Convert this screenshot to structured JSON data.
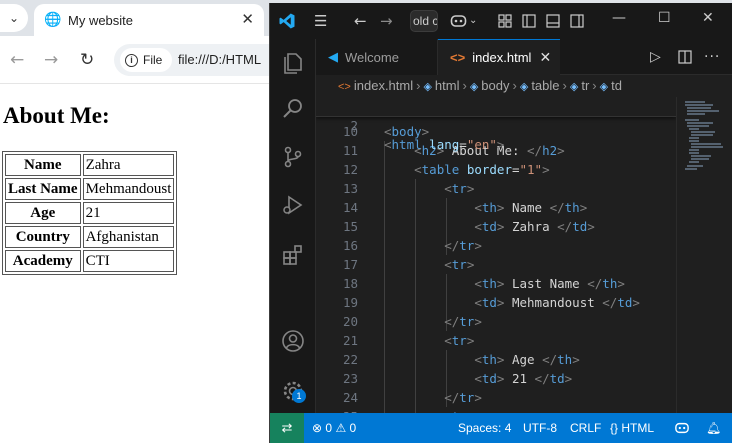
{
  "browser": {
    "tab_title": "My website",
    "omnibox": {
      "chip_label": "File",
      "url": "file:///D:/HTML"
    },
    "page": {
      "heading": "About Me:",
      "rows": [
        {
          "th": "Name",
          "td": "Zahra"
        },
        {
          "th": "Last Name",
          "td": "Mehmandoust"
        },
        {
          "th": "Age",
          "td": "21"
        },
        {
          "th": "Country",
          "td": "Afghanistan"
        },
        {
          "th": "Academy",
          "td": "CTI"
        }
      ]
    }
  },
  "vscode": {
    "search_text": "old c",
    "tabs": [
      {
        "label": "Welcome",
        "icon": "vscode-icon"
      },
      {
        "label": "index.html",
        "icon": "html-file-icon"
      }
    ],
    "breadcrumbs": [
      "index.html",
      "html",
      "body",
      "table",
      "tr",
      "td"
    ],
    "sticky_line": {
      "num": "2",
      "open": "<",
      "tag": "html",
      "attr": "lang",
      "eq": "=",
      "val": "\"en\"",
      "close": ">"
    },
    "lines": [
      {
        "num": "10",
        "open": "<",
        "tag": "body",
        "close": ">"
      },
      {
        "num": "11",
        "open": "<",
        "tag": "h2",
        "close": ">",
        "text": " About Me: ",
        "endopen": "</",
        "endtag": "h2",
        "endclose": ">"
      },
      {
        "num": "12",
        "open": "<",
        "tag": "table",
        "attr": "border",
        "eq": "=",
        "val": "\"1\"",
        "close": ">"
      },
      {
        "num": "13",
        "open": "<",
        "tag": "tr",
        "close": ">"
      },
      {
        "num": "14",
        "open": "<",
        "tag": "th",
        "close": ">",
        "text": " Name ",
        "endopen": "</",
        "endtag": "th",
        "endclose": ">"
      },
      {
        "num": "15",
        "open": "<",
        "tag": "td",
        "close": ">",
        "text": " Zahra ",
        "endopen": "</",
        "endtag": "td",
        "endclose": ">"
      },
      {
        "num": "16",
        "open": "</",
        "tag": "tr",
        "close": ">"
      },
      {
        "num": "17",
        "open": "<",
        "tag": "tr",
        "close": ">"
      },
      {
        "num": "18",
        "open": "<",
        "tag": "th",
        "close": ">",
        "text": " Last Name ",
        "endopen": "</",
        "endtag": "th",
        "endclose": ">"
      },
      {
        "num": "19",
        "open": "<",
        "tag": "td",
        "close": ">",
        "text": " Mehmandoust ",
        "endopen": "</",
        "endtag": "td",
        "endclose": ">"
      },
      {
        "num": "20",
        "open": "</",
        "tag": "tr",
        "close": ">"
      },
      {
        "num": "21",
        "open": "<",
        "tag": "tr",
        "close": ">"
      },
      {
        "num": "22",
        "open": "<",
        "tag": "th",
        "close": ">",
        "text": " Age ",
        "endopen": "</",
        "endtag": "th",
        "endclose": ">"
      },
      {
        "num": "23",
        "open": "<",
        "tag": "td",
        "close": ">",
        "text": " 21 ",
        "endopen": "</",
        "endtag": "td",
        "endclose": ">"
      },
      {
        "num": "24",
        "open": "</",
        "tag": "tr",
        "close": ">"
      },
      {
        "num": "25",
        "open": "<",
        "tag": "tr",
        "close": ">"
      }
    ],
    "accounts_badge": "1",
    "status": {
      "errors": "0",
      "warnings": "0",
      "spaces": "Spaces: 4",
      "encoding": "UTF-8",
      "eol": "CRLF",
      "language_brace": "{}",
      "language": "HTML"
    }
  },
  "colors": {
    "vscode_accent": "#0078d4",
    "remote_green": "#16825d",
    "html_tag_blue": "#569cd6",
    "attr_light_blue": "#9cdcfe",
    "string_orange": "#ce9178"
  }
}
